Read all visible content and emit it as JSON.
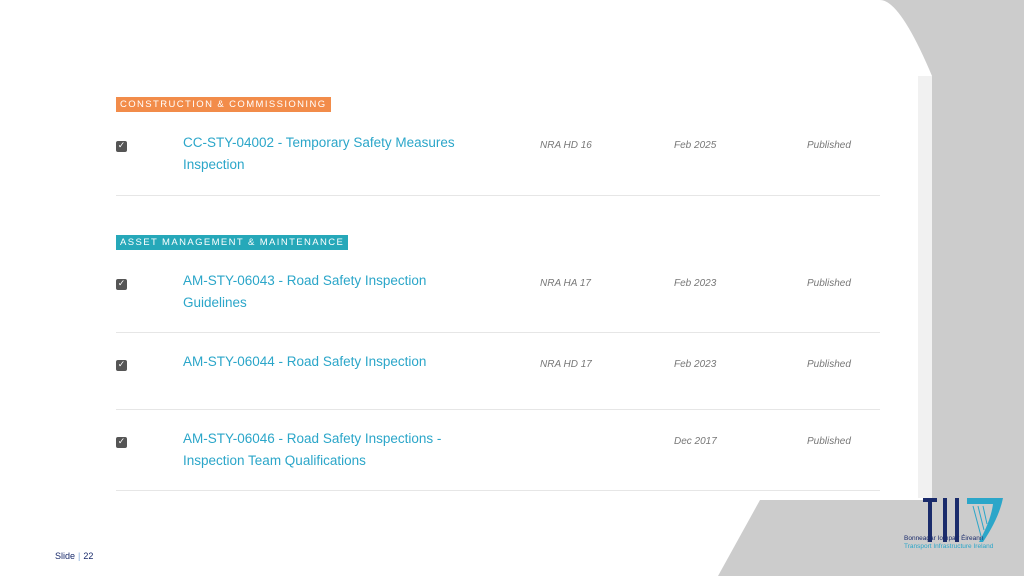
{
  "colors": {
    "construction_tag": "#f28c4a",
    "asset_tag": "#26a8b9",
    "link": "#2ba6c9",
    "background_shape": "#cccccc",
    "logo_navy": "#1a2b6b"
  },
  "sections": [
    {
      "tag": "CONSTRUCTION & COMMISSIONING",
      "rows": [
        {
          "checked": true,
          "title_line1": "CC-STY-04002 - Temporary Safety Measures",
          "title_line2": "Inspection",
          "ref": "NRA HD 16",
          "date": "Feb 2025",
          "status": "Published"
        }
      ]
    },
    {
      "tag": "ASSET MANAGEMENT & MAINTENANCE",
      "rows": [
        {
          "checked": true,
          "title_line1": "AM-STY-06043 - Road Safety Inspection",
          "title_line2": "Guidelines",
          "ref": "NRA HA 17",
          "date": "Feb 2023",
          "status": "Published"
        },
        {
          "checked": true,
          "title_line1": "AM-STY-06044 - Road Safety Inspection",
          "title_line2": "",
          "ref": "NRA HD 17",
          "date": "Feb 2023",
          "status": "Published"
        },
        {
          "checked": true,
          "title_line1": "AM-STY-06046 - Road Safety Inspections -",
          "title_line2": "Inspection Team Qualifications",
          "ref": "",
          "date": "Dec 2017",
          "status": "Published"
        }
      ]
    }
  ],
  "checkmark_glyph": "✓",
  "logo": {
    "icon": "tii-harp-logo-icon",
    "irish_name": "Bonneagar Iompair Éireann",
    "english_name": "Transport Infrastructure Ireland"
  },
  "footer": {
    "slide_label": "Slide",
    "separator": "|",
    "slide_number": "22"
  }
}
